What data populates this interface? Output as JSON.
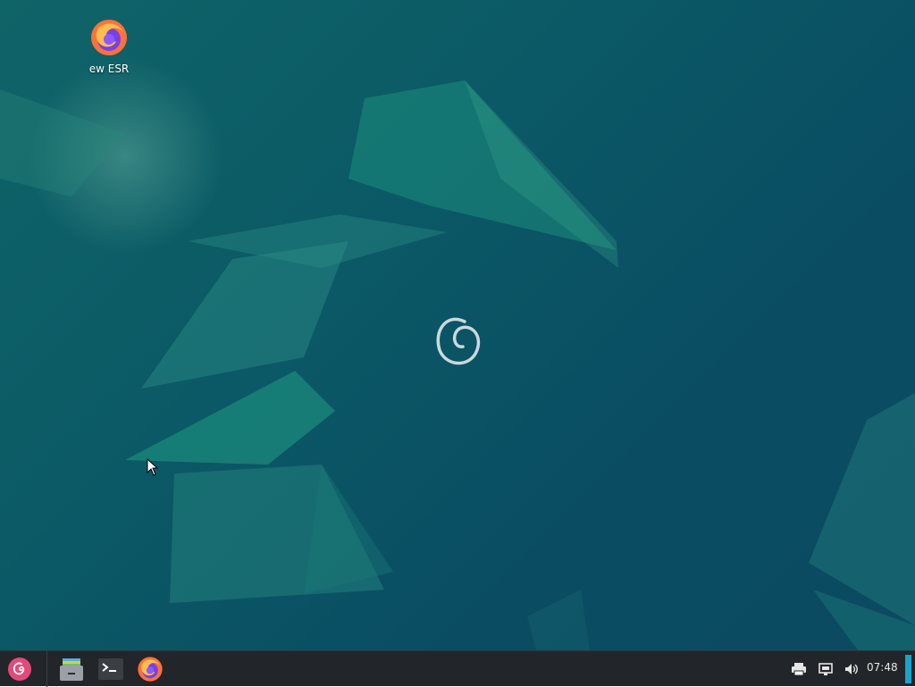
{
  "desktop": {
    "icons": [
      {
        "label": "ew ESR",
        "icon": "firefox-icon"
      }
    ]
  },
  "taskbar": {
    "start_menu_icon": "debian-swirl-icon",
    "launchers": [
      {
        "name": "file-manager",
        "icon": "file-cabinet-icon"
      },
      {
        "name": "terminal",
        "icon": "terminal-icon"
      },
      {
        "name": "firefox",
        "icon": "firefox-icon"
      }
    ],
    "tray": [
      {
        "name": "printer",
        "icon": "printer-icon"
      },
      {
        "name": "network",
        "icon": "network-icon"
      },
      {
        "name": "volume",
        "icon": "volume-icon"
      }
    ],
    "clock": "07:48"
  },
  "colors": {
    "taskbar_bg": "#222529",
    "wallpaper_base": "#0b5064",
    "accent": "#1aa3c9",
    "debian_red": "#d70a53"
  }
}
